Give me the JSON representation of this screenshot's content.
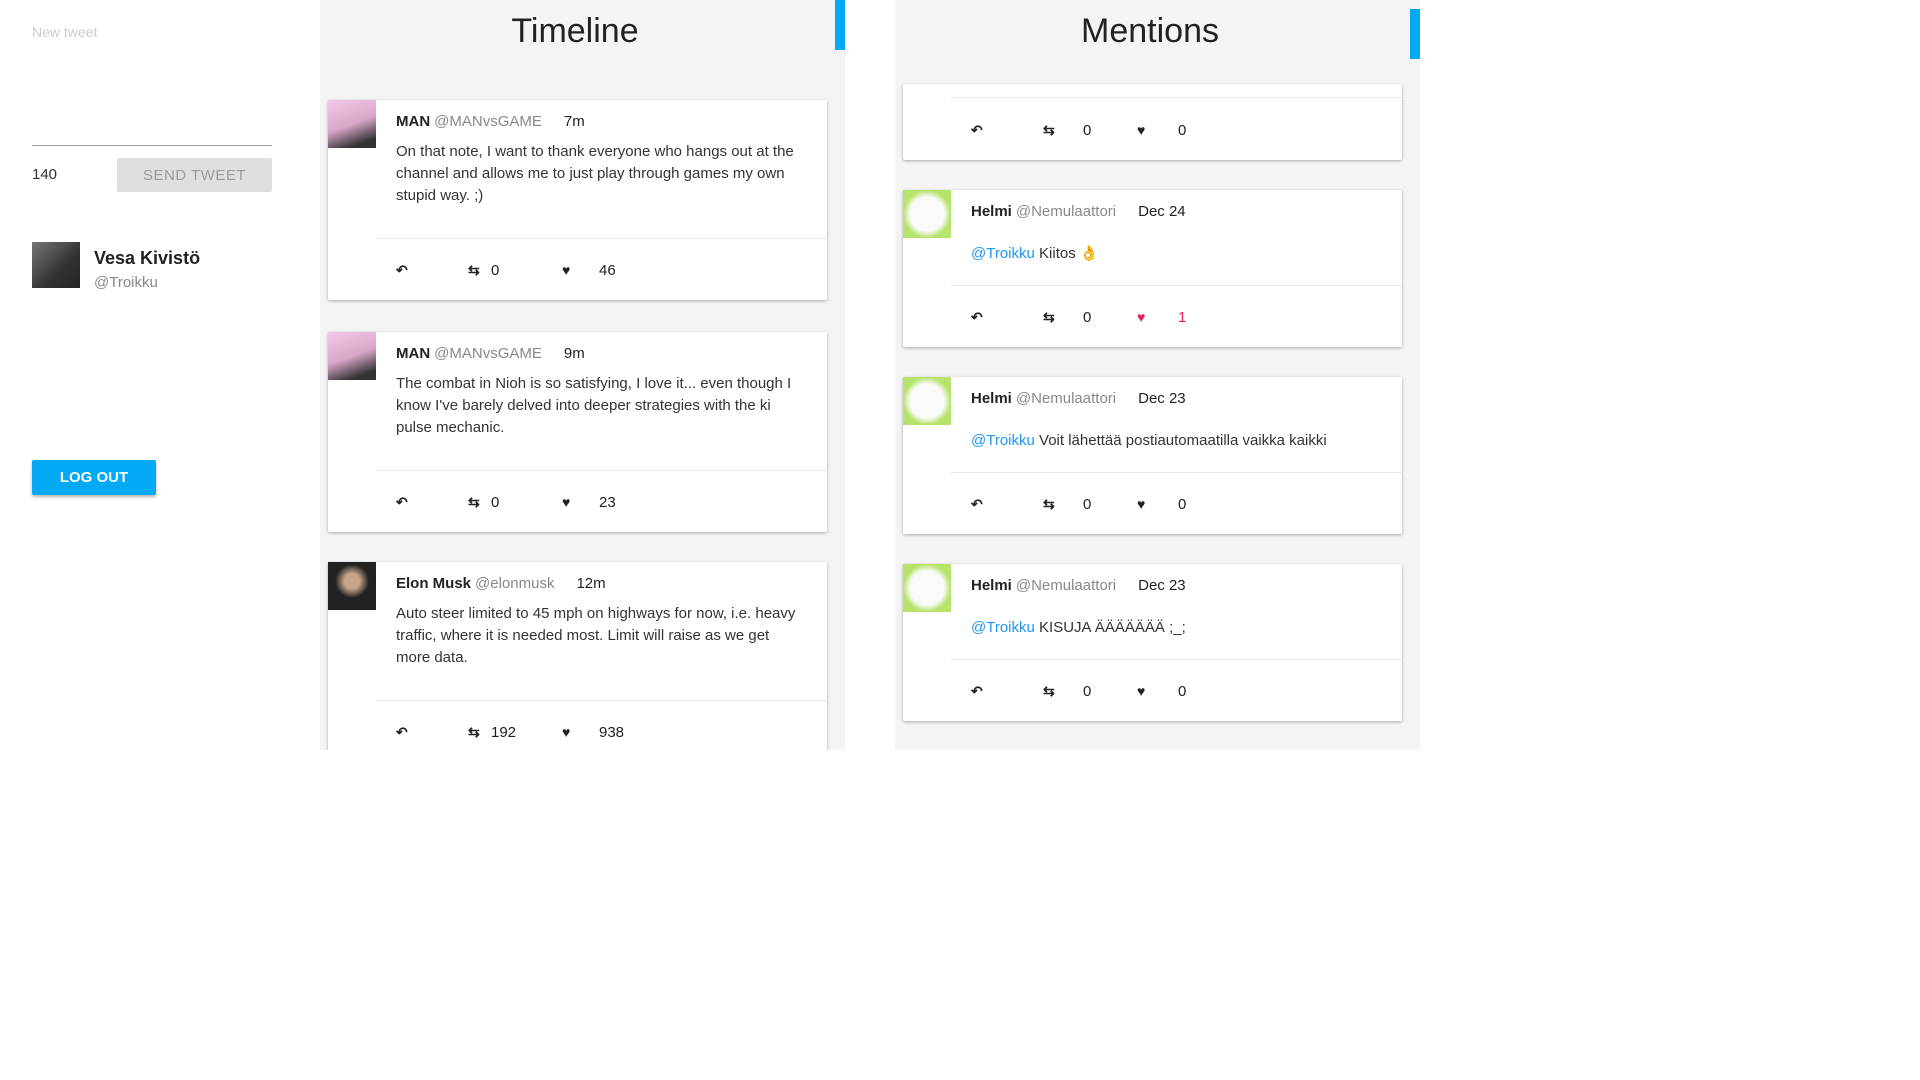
{
  "compose": {
    "placeholder": "New tweet",
    "remaining": "140",
    "send_label": "SEND TWEET"
  },
  "user": {
    "name": "Vesa Kivistö",
    "handle": "@Troikku"
  },
  "logout_label": "LOG OUT",
  "timeline": {
    "title": "Timeline",
    "tweets": [
      {
        "name": "MAN",
        "handle": "@MANvsGAME",
        "time": "7m",
        "text": "On that note, I want to thank everyone who hangs out at the channel and allows me to just play through games my own stupid way. ;)",
        "retweets": "0",
        "likes": "46"
      },
      {
        "name": "MAN",
        "handle": "@MANvsGAME",
        "time": "9m",
        "text": "The combat in Nioh is so satisfying, I love it... even though I know I've barely delved into deeper strategies with the ki pulse mechanic.",
        "retweets": "0",
        "likes": "23"
      },
      {
        "name": "Elon Musk",
        "handle": "@elonmusk",
        "time": "12m",
        "text": "Auto steer limited to 45 mph on highways for now, i.e. heavy traffic, where it is needed most. Limit will raise as we get more data.",
        "retweets": "192",
        "likes": "938"
      }
    ]
  },
  "mentions": {
    "title": "Mentions",
    "partial": {
      "retweets": "0",
      "likes": "0"
    },
    "tweets": [
      {
        "name": "Helmi",
        "handle": "@Nemulaattori",
        "time": "Dec 24",
        "mention": "@Troikku",
        "text": " Kiitos 👌",
        "retweets": "0",
        "likes": "1",
        "liked": true
      },
      {
        "name": "Helmi",
        "handle": "@Nemulaattori",
        "time": "Dec 23",
        "mention": "@Troikku",
        "text": " Voit lähettää postiautomaatilla vaikka kaikki",
        "retweets": "0",
        "likes": "0"
      },
      {
        "name": "Helmi",
        "handle": "@Nemulaattori",
        "time": "Dec 23",
        "mention": "@Troikku",
        "text": " KISUJA ÄÄÄÄÄÄÄ ;_;",
        "retweets": "0",
        "likes": "0"
      }
    ]
  },
  "colors": {
    "accent": "#03a9f4",
    "liked": "#e91e63",
    "mention": "#2196f3"
  }
}
